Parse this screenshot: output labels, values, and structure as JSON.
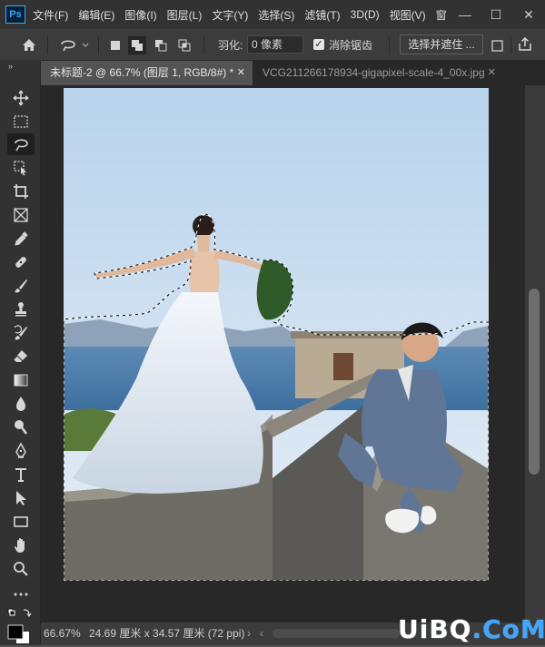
{
  "app": {
    "logo": "Ps"
  },
  "menu": {
    "items": [
      "文件(F)",
      "编辑(E)",
      "图像(I)",
      "图层(L)",
      "文字(Y)",
      "选择(S)",
      "滤镜(T)",
      "3D(D)",
      "视图(V)",
      "窗"
    ]
  },
  "window_controls": {
    "minimize": "—",
    "maximize": "☐",
    "close": "✕"
  },
  "options": {
    "feather_label": "羽化:",
    "feather_value": "0 像素",
    "antialias_checked": true,
    "antialias_label": "消除锯齿",
    "select_mask_label": "选择并遮住 ..."
  },
  "tabs": [
    {
      "label": "未标题-2 @ 66.7% (图层 1, RGB/8#) *",
      "active": true
    },
    {
      "label": "VCG211266178934-gigapixel-scale-4_00x.jpg",
      "active": false
    }
  ],
  "status": {
    "zoom": "66.67%",
    "doc_info": "24.69 厘米 x 34.57 厘米 (72 ppi)"
  },
  "watermark": {
    "part1": "UiBQ",
    "part2": ".CoM"
  },
  "colors": {
    "accent": "#31a8ff",
    "panel": "#323232",
    "canvas_bg": "#282828"
  }
}
